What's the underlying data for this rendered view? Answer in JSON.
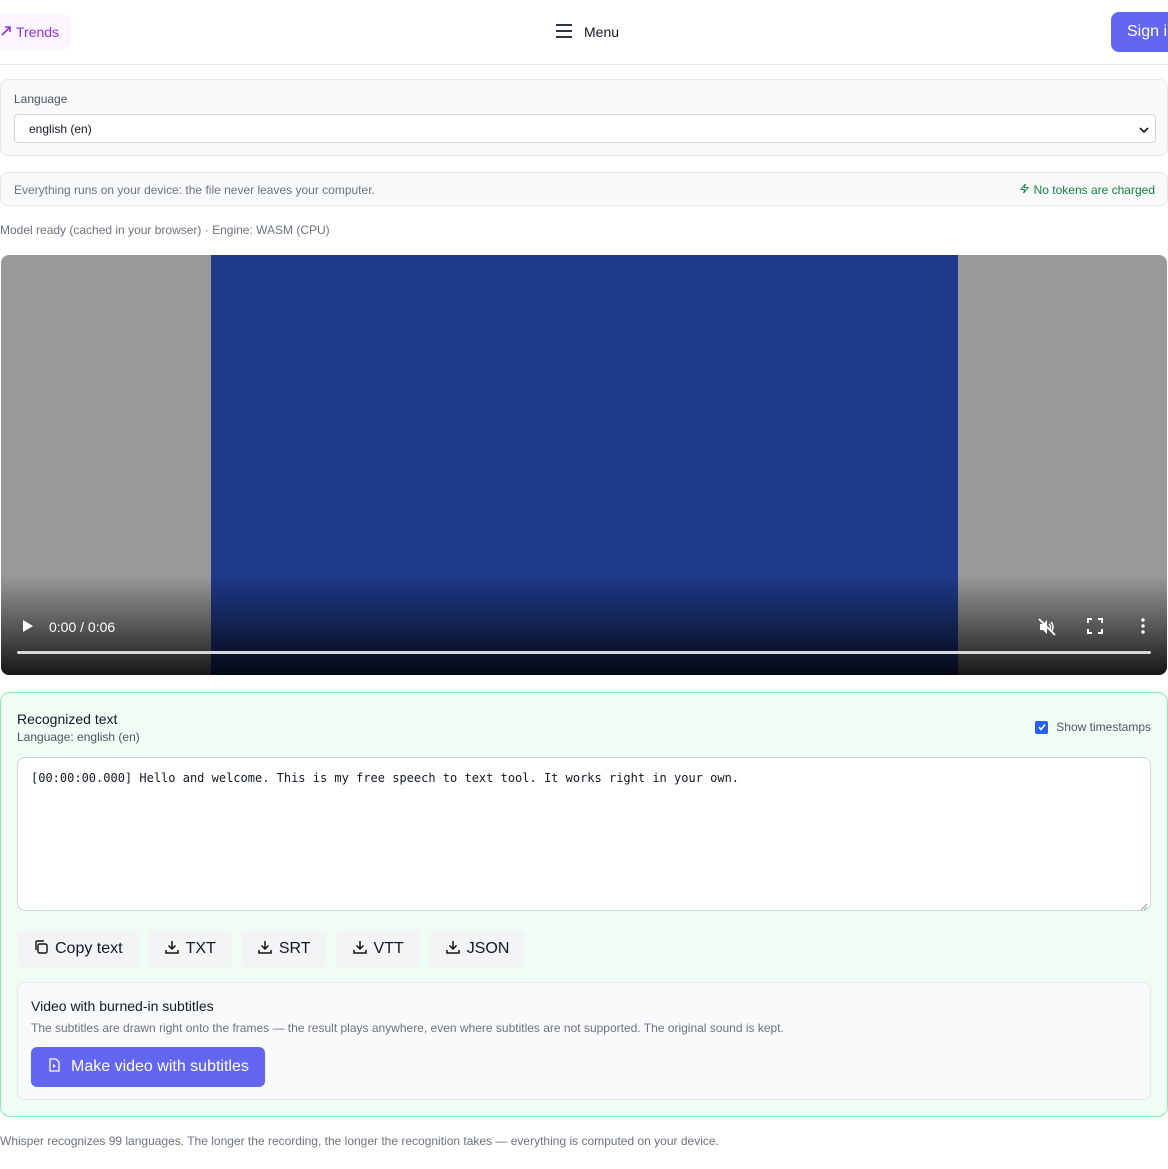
{
  "header": {
    "trends_label": "Trends",
    "menu_label": "Menu",
    "signin_label": "Sign i"
  },
  "language_panel": {
    "label": "Language",
    "selected": "english (en)"
  },
  "info": {
    "text": "Everything runs on your device: the file never leaves your computer.",
    "badge": "No tokens are charged"
  },
  "status": "Model ready (cached in your browser) · Engine: WASM (CPU)",
  "video": {
    "time": "0:00 / 0:06",
    "progress": 0
  },
  "result": {
    "title": "Recognized text",
    "language": "Language: english (en)",
    "show_timestamps_label": "Show timestamps",
    "show_timestamps_checked": true,
    "transcript": "[00:00:00.000] Hello and welcome. This is my free speech to text tool. It works right in your own.",
    "buttons": {
      "copy": "Copy text",
      "txt": "TXT",
      "srt": "SRT",
      "vtt": "VTT",
      "json": "JSON"
    },
    "burn": {
      "title": "Video with burned-in subtitles",
      "description": "The subtitles are drawn right onto the frames — the result plays anywhere, even where subtitles are not supported. The original sound is kept.",
      "button": "Make video with subtitles"
    }
  },
  "footer_note": "Whisper recognizes 99 languages. The longer the recording, the longer the recognition takes — everything is computed on your device.",
  "colors": {
    "accent": "#6366f1",
    "trends": "#9333ea",
    "success": "#15803d",
    "result_bg": "#f0fdf4",
    "result_border": "#86efac",
    "video_frame": "#1f3a8a"
  }
}
